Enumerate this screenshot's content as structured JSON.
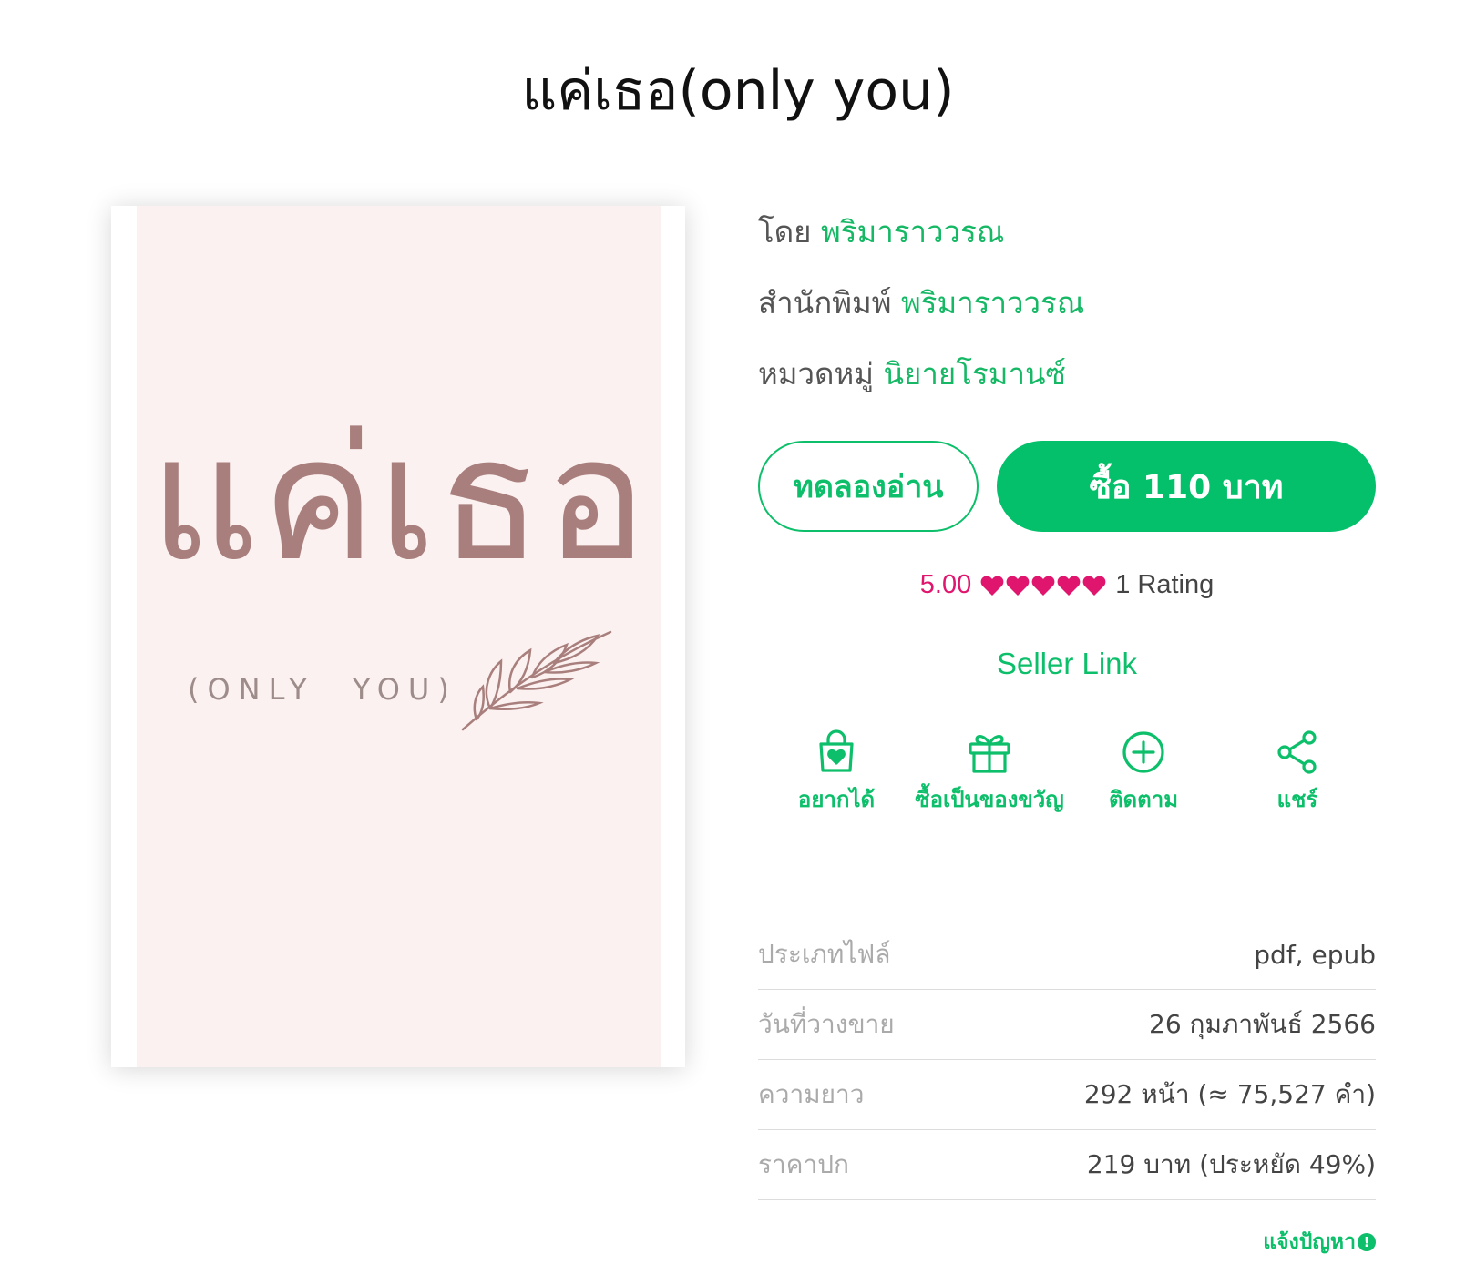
{
  "page": {
    "title": "แค่เธอ(only you)"
  },
  "cover": {
    "title": "แค่เธอ",
    "subtitle": "(ONLY YOU)"
  },
  "meta": [
    {
      "label": "โดย",
      "value": "พริมาราววรณ"
    },
    {
      "label": "สำนักพิมพ์",
      "value": "พริมาราววรณ"
    },
    {
      "label": "หมวดหมู่",
      "value": "นิยายโรมานซ์"
    }
  ],
  "buttons": {
    "sample": "ทดลองอ่าน",
    "buy": "ซื้อ 110 บาท"
  },
  "rating": {
    "score": "5.00",
    "hearts": 5,
    "count": "1 Rating",
    "color": "#e0166e"
  },
  "seller_link": "Seller Link",
  "actions": [
    {
      "icon": "wishlist-bag-heart-icon",
      "label": "อยากได้"
    },
    {
      "icon": "gift-icon",
      "label": "ซื้อเป็นของขวัญ"
    },
    {
      "icon": "plus-circle-icon",
      "label": "ติดตาม"
    },
    {
      "icon": "share-icon",
      "label": "แชร์"
    }
  ],
  "details": [
    {
      "label": "ประเภทไฟล์",
      "value": "pdf, epub"
    },
    {
      "label": "วันที่วางขาย",
      "value": "26 กุมภาพันธ์ 2566"
    },
    {
      "label": "ความยาว",
      "value": "292 หน้า (≈ 75,527 คำ)"
    },
    {
      "label": "ราคาปก",
      "value": "219 บาท (ประหยัด 49%)"
    }
  ],
  "report": {
    "label": "แจ้งปัญหา",
    "icon": "!"
  },
  "colors": {
    "accent": "#05c06b",
    "cover_bg": "#fbf1f0",
    "cover_text": "#a87f7c"
  }
}
